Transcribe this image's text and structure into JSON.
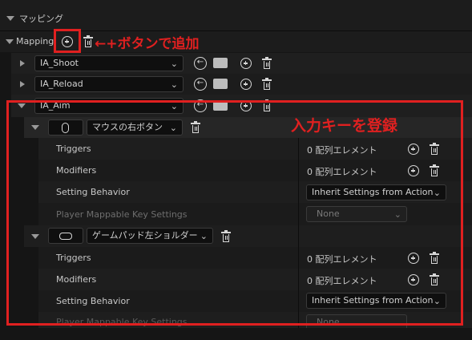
{
  "section": {
    "title": "マッピング"
  },
  "mapping": {
    "label": "Mapping"
  },
  "annotations": {
    "add_button_note": "←+ボタンで追加",
    "key_register_note": "入力キーを登録"
  },
  "actions": [
    {
      "name": "IA_Shoot"
    },
    {
      "name": "IA_Reload"
    },
    {
      "name": "IA_Aim"
    }
  ],
  "keys": [
    {
      "key_icon": "mouse-icon",
      "key_name": "マウスの右ボタン",
      "rows": [
        {
          "label": "Triggers",
          "value": "0 配列エレメント"
        },
        {
          "label": "Modifiers",
          "value": "0 配列エレメント"
        },
        {
          "label": "Setting Behavior",
          "value": "Inherit Settings from Action"
        },
        {
          "label": "Player Mappable Key Settings",
          "value": "None"
        }
      ]
    },
    {
      "key_icon": "gamepad-icon",
      "key_name": "ゲームパッド左ショルダー",
      "rows": [
        {
          "label": "Triggers",
          "value": "0 配列エレメント"
        },
        {
          "label": "Modifiers",
          "value": "0 配列エレメント"
        },
        {
          "label": "Setting Behavior",
          "value": "Inherit Settings from Action"
        },
        {
          "label": "Player Mappable Key Settings",
          "value": "None"
        }
      ]
    }
  ],
  "colors": {
    "annotation": "#e02020",
    "background": "#151515"
  }
}
